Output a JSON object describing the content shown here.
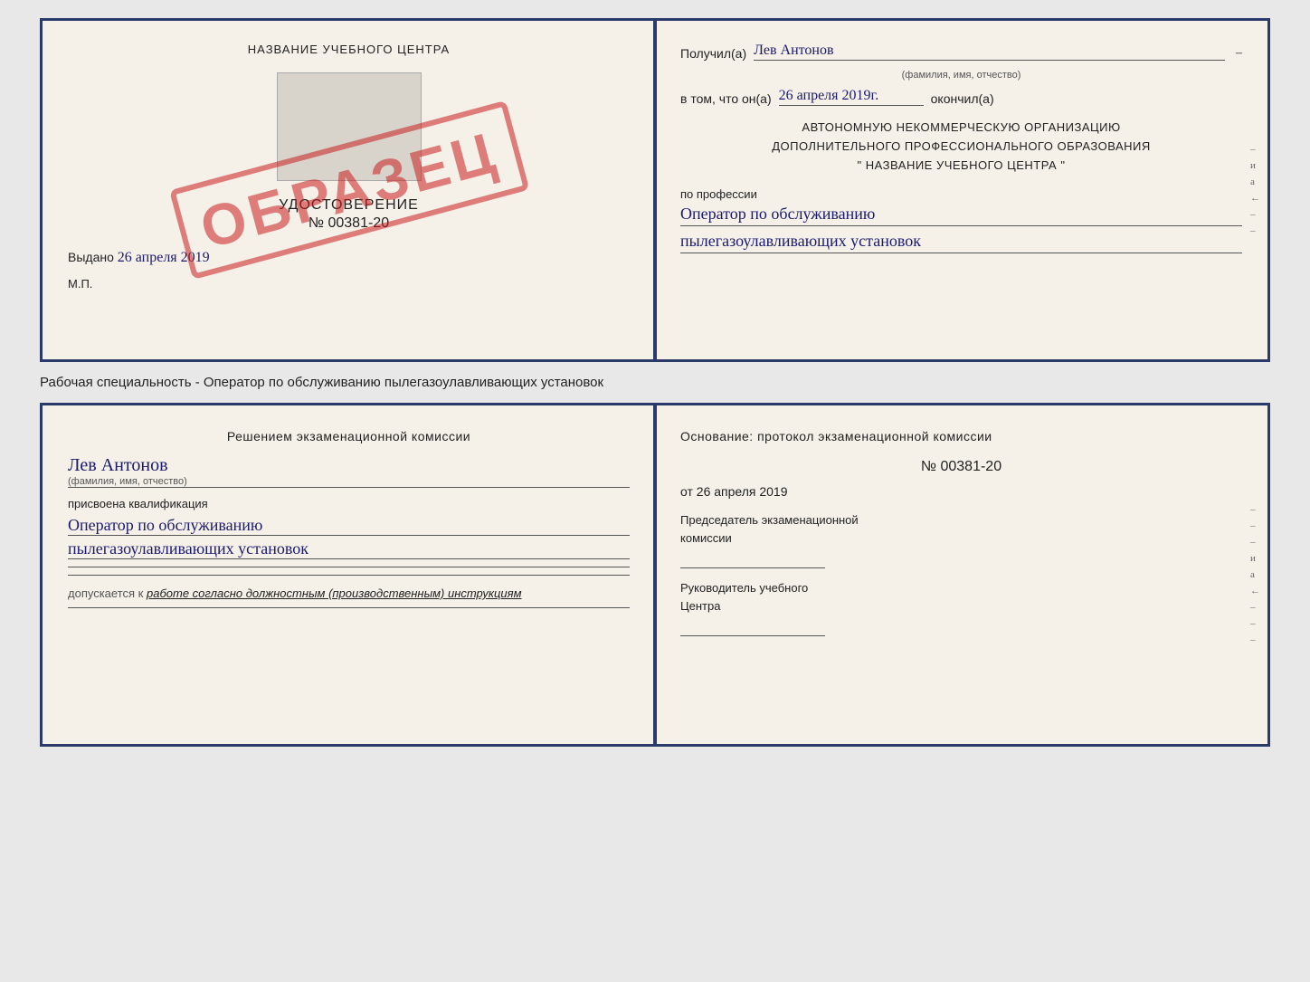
{
  "top_cert": {
    "left": {
      "title": "НАЗВАНИЕ УЧЕБНОГО ЦЕНТРА",
      "udost_label": "УДОСТОВЕРЕНИЕ",
      "udost_number": "№ 00381-20",
      "vydano_label": "Выдано",
      "vydano_date": "26 апреля 2019",
      "mp": "М.П.",
      "obrazec": "ОБРАЗЕЦ"
    },
    "right": {
      "poluchil_label": "Получил(а)",
      "poluchil_value": "Лев Антонов",
      "poluchil_sub": "(фамилия, имя, отчество)",
      "dash1": "–",
      "vtom_label": "в том, что он(а)",
      "vtom_value": "26 апреля 2019г.",
      "okonchill_label": "окончил(а)",
      "block_line1": "АВТОНОМНУЮ НЕКОММЕРЧЕСКУЮ ОРГАНИЗАЦИЮ",
      "block_line2": "ДОПОЛНИТЕЛЬНОГО ПРОФЕССИОНАЛЬНОГО ОБРАЗОВАНИЯ",
      "block_line3": "\"  НАЗВАНИЕ УЧЕБНОГО ЦЕНТРА  \"",
      "dash2": "–",
      "dash3": "–",
      "po_professii": "по профессии",
      "profession_line1": "Оператор по обслуживанию",
      "profession_line2": "пылегазоулавливающих установок",
      "dash4": "–",
      "dash5": "–",
      "edge": [
        "и",
        "а",
        "←",
        "–",
        "–",
        "–"
      ]
    }
  },
  "specialty_text": "Рабочая специальность - Оператор по обслуживанию пылегазоулавливающих установок",
  "bottom_cert": {
    "left": {
      "title_line1": "Решением экзаменационной комиссии",
      "name": "Лев Антонов",
      "name_sub": "(фамилия, имя, отчество)",
      "prisvoyena": "присвоена квалификация",
      "qual_line1": "Оператор по обслуживанию",
      "qual_line2": "пылегазоулавливающих установок",
      "dopusk_label": "допускается к",
      "dopusk_value": "работе согласно должностным (производственным) инструкциям"
    },
    "right": {
      "osnov_label": "Основание: протокол экзаменационной комиссии",
      "protocol_num": "№ 00381-20",
      "date_prefix": "от",
      "date_value": "26 апреля 2019",
      "predsedatel_line1": "Председатель экзаменационной",
      "predsedatel_line2": "комиссии",
      "rukov_line1": "Руководитель учебного",
      "rukov_line2": "Центра",
      "edge": [
        "–",
        "–",
        "–",
        "и",
        "а",
        "←",
        "–",
        "–",
        "–"
      ]
    }
  }
}
